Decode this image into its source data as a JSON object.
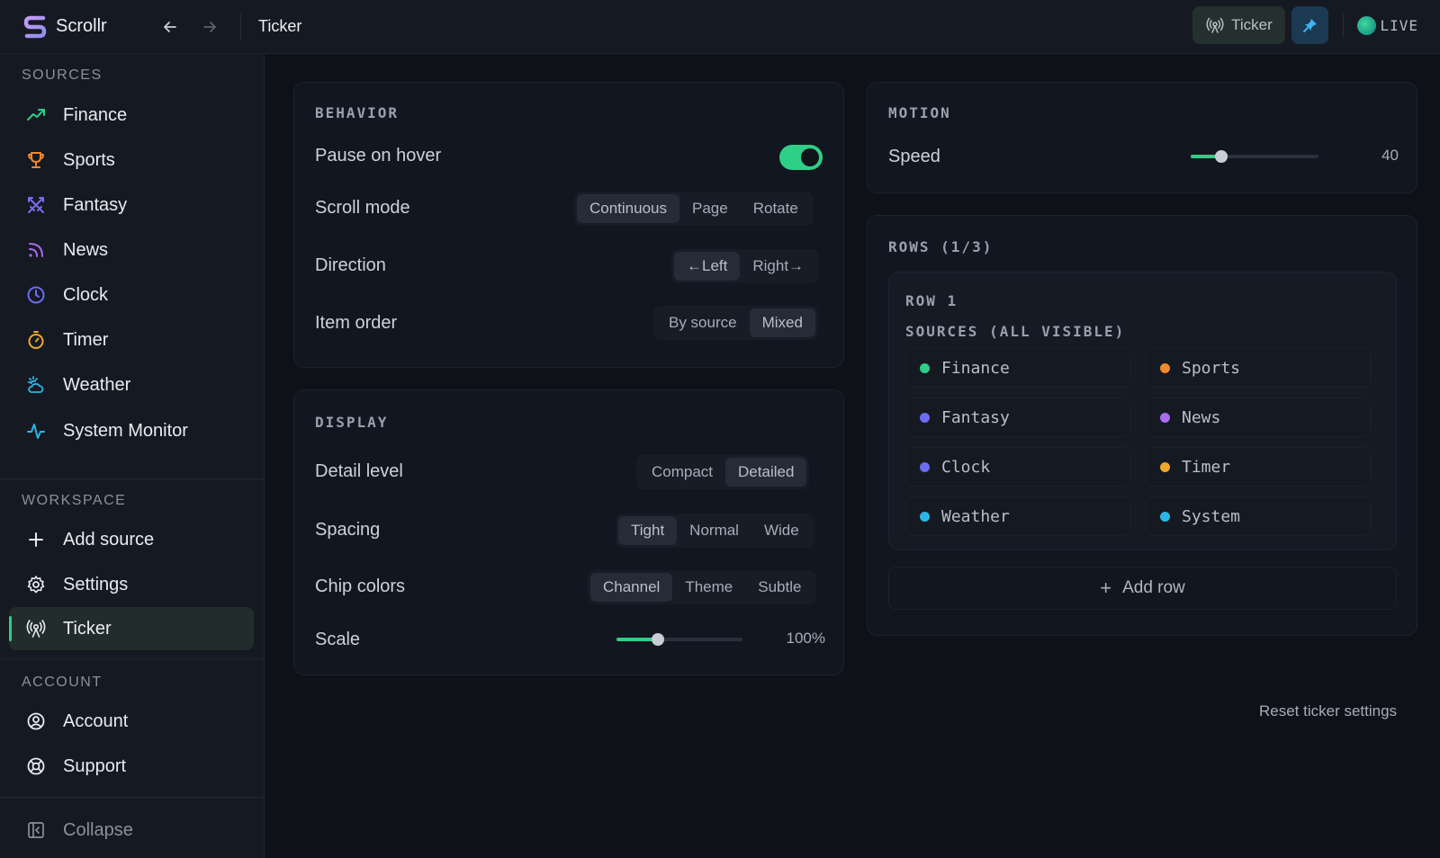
{
  "app": {
    "name": "Scrollr",
    "page_title": "Ticker"
  },
  "topbar": {
    "ticker_button": "Ticker",
    "live_label": "LIVE"
  },
  "sidebar": {
    "sources_label": "SOURCES",
    "sources": [
      {
        "label": "Finance",
        "icon": "trending-up-icon",
        "color": "#2ecf86"
      },
      {
        "label": "Sports",
        "icon": "trophy-icon",
        "color": "#f08a2c"
      },
      {
        "label": "Fantasy",
        "icon": "swords-icon",
        "color": "#7c6cf2"
      },
      {
        "label": "News",
        "icon": "rss-icon",
        "color": "#a76cf2"
      },
      {
        "label": "Clock",
        "icon": "clock-icon",
        "color": "#6c6cf2"
      },
      {
        "label": "Timer",
        "icon": "timer-icon",
        "color": "#f0a62c"
      },
      {
        "label": "Weather",
        "icon": "cloud-sun-icon",
        "color": "#2cb6e6"
      },
      {
        "label": "System Monitor",
        "icon": "activity-icon",
        "color": "#2cb6e6"
      }
    ],
    "workspace_label": "WORKSPACE",
    "workspace": [
      {
        "label": "Add source",
        "icon": "plus-icon"
      },
      {
        "label": "Settings",
        "icon": "gear-icon"
      },
      {
        "label": "Ticker",
        "icon": "broadcast-icon",
        "active": true
      }
    ],
    "account_label": "ACCOUNT",
    "account": [
      {
        "label": "Account",
        "icon": "user-circle-icon"
      },
      {
        "label": "Support",
        "icon": "life-buoy-icon"
      }
    ],
    "collapse_label": "Collapse"
  },
  "behavior": {
    "title": "BEHAVIOR",
    "pause_on_hover": {
      "label": "Pause on hover",
      "on": true
    },
    "scroll_mode": {
      "label": "Scroll mode",
      "options": [
        "Continuous",
        "Page",
        "Rotate"
      ],
      "selected": "Continuous"
    },
    "direction": {
      "label": "Direction",
      "options": [
        "←Left",
        "Right→"
      ],
      "selected": "←Left"
    },
    "item_order": {
      "label": "Item order",
      "options": [
        "By source",
        "Mixed"
      ],
      "selected": "Mixed"
    }
  },
  "display": {
    "title": "DISPLAY",
    "detail_level": {
      "label": "Detail level",
      "options": [
        "Compact",
        "Detailed"
      ],
      "selected": "Detailed"
    },
    "spacing": {
      "label": "Spacing",
      "options": [
        "Tight",
        "Normal",
        "Wide"
      ],
      "selected": "Tight"
    },
    "chip_colors": {
      "label": "Chip colors",
      "options": [
        "Channel",
        "Theme",
        "Subtle"
      ],
      "selected": "Channel"
    },
    "scale": {
      "label": "Scale",
      "value_text": "100%",
      "fraction": 0.33
    }
  },
  "motion": {
    "title": "MOTION",
    "speed": {
      "label": "Speed",
      "value_text": "40",
      "fraction": 0.24
    }
  },
  "rows": {
    "title": "ROWS (1/3)",
    "row1": {
      "title": "ROW 1",
      "sources_label": "SOURCES (ALL VISIBLE)",
      "chips": [
        {
          "label": "Finance",
          "color": "#2ecf86"
        },
        {
          "label": "Sports",
          "color": "#f08a2c"
        },
        {
          "label": "Fantasy",
          "color": "#6c6cf2"
        },
        {
          "label": "News",
          "color": "#a76cf2"
        },
        {
          "label": "Clock",
          "color": "#6c6cf2"
        },
        {
          "label": "Timer",
          "color": "#f0a62c"
        },
        {
          "label": "Weather",
          "color": "#2cb6e6"
        },
        {
          "label": "System",
          "color": "#2cb6e6"
        }
      ]
    },
    "add_row": "Add row"
  },
  "reset_label": "Reset ticker settings"
}
